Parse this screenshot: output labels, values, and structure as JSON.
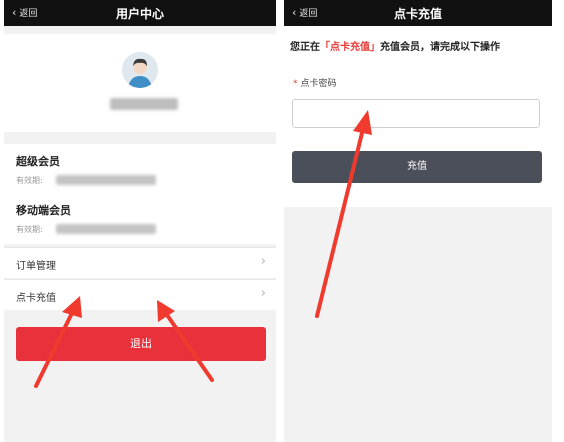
{
  "left_screen": {
    "nav": {
      "back_label": "返回",
      "title": "用户中心"
    },
    "memberships": [
      {
        "title": "超级会员",
        "label": "有效期:"
      },
      {
        "title": "移动端会员",
        "label": "有效期:"
      }
    ],
    "menu": [
      {
        "label": "订单管理"
      },
      {
        "label": "点卡充值"
      }
    ],
    "logout_label": "退出"
  },
  "right_screen": {
    "nav": {
      "back_label": "返回",
      "title": "点卡充值"
    },
    "notice": {
      "prefix": "您正在",
      "highlight": "「点卡充值」",
      "suffix": "充值会员，请完成以下操作"
    },
    "field": {
      "required_mark": "*",
      "label": "点卡密码",
      "value": ""
    },
    "recharge_label": "充值"
  },
  "colors": {
    "accent_red": "#e8313a",
    "dark_button": "#4a4f59",
    "navbar": "#111111",
    "annotation_arrow": "#f03a2e"
  }
}
